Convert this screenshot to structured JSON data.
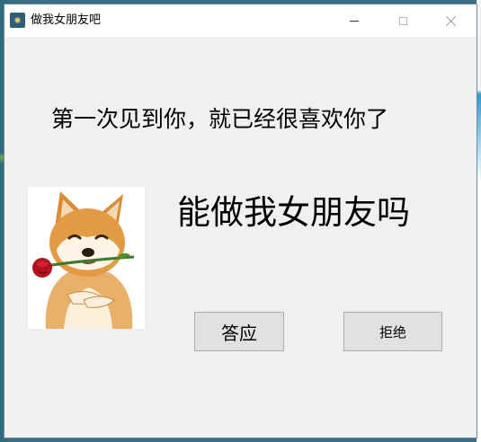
{
  "window": {
    "title": "做我女朋友吧"
  },
  "content": {
    "subtitle": "第一次见到你，就已经很喜欢你了",
    "headline": "能做我女朋友吗",
    "image_subject": "shiba-dog-holding-rose"
  },
  "buttons": {
    "accept_label": "答应",
    "reject_label": "拒绝"
  },
  "colors": {
    "window_bg": "#f0f0f0",
    "titlebar_bg": "#ffffff",
    "button_bg": "#e1e1e1",
    "button_border": "#adadad",
    "desktop_bg": "#3a6f86"
  },
  "icons": [
    "app-icon",
    "minimize-icon",
    "maximize-icon",
    "close-icon"
  ]
}
